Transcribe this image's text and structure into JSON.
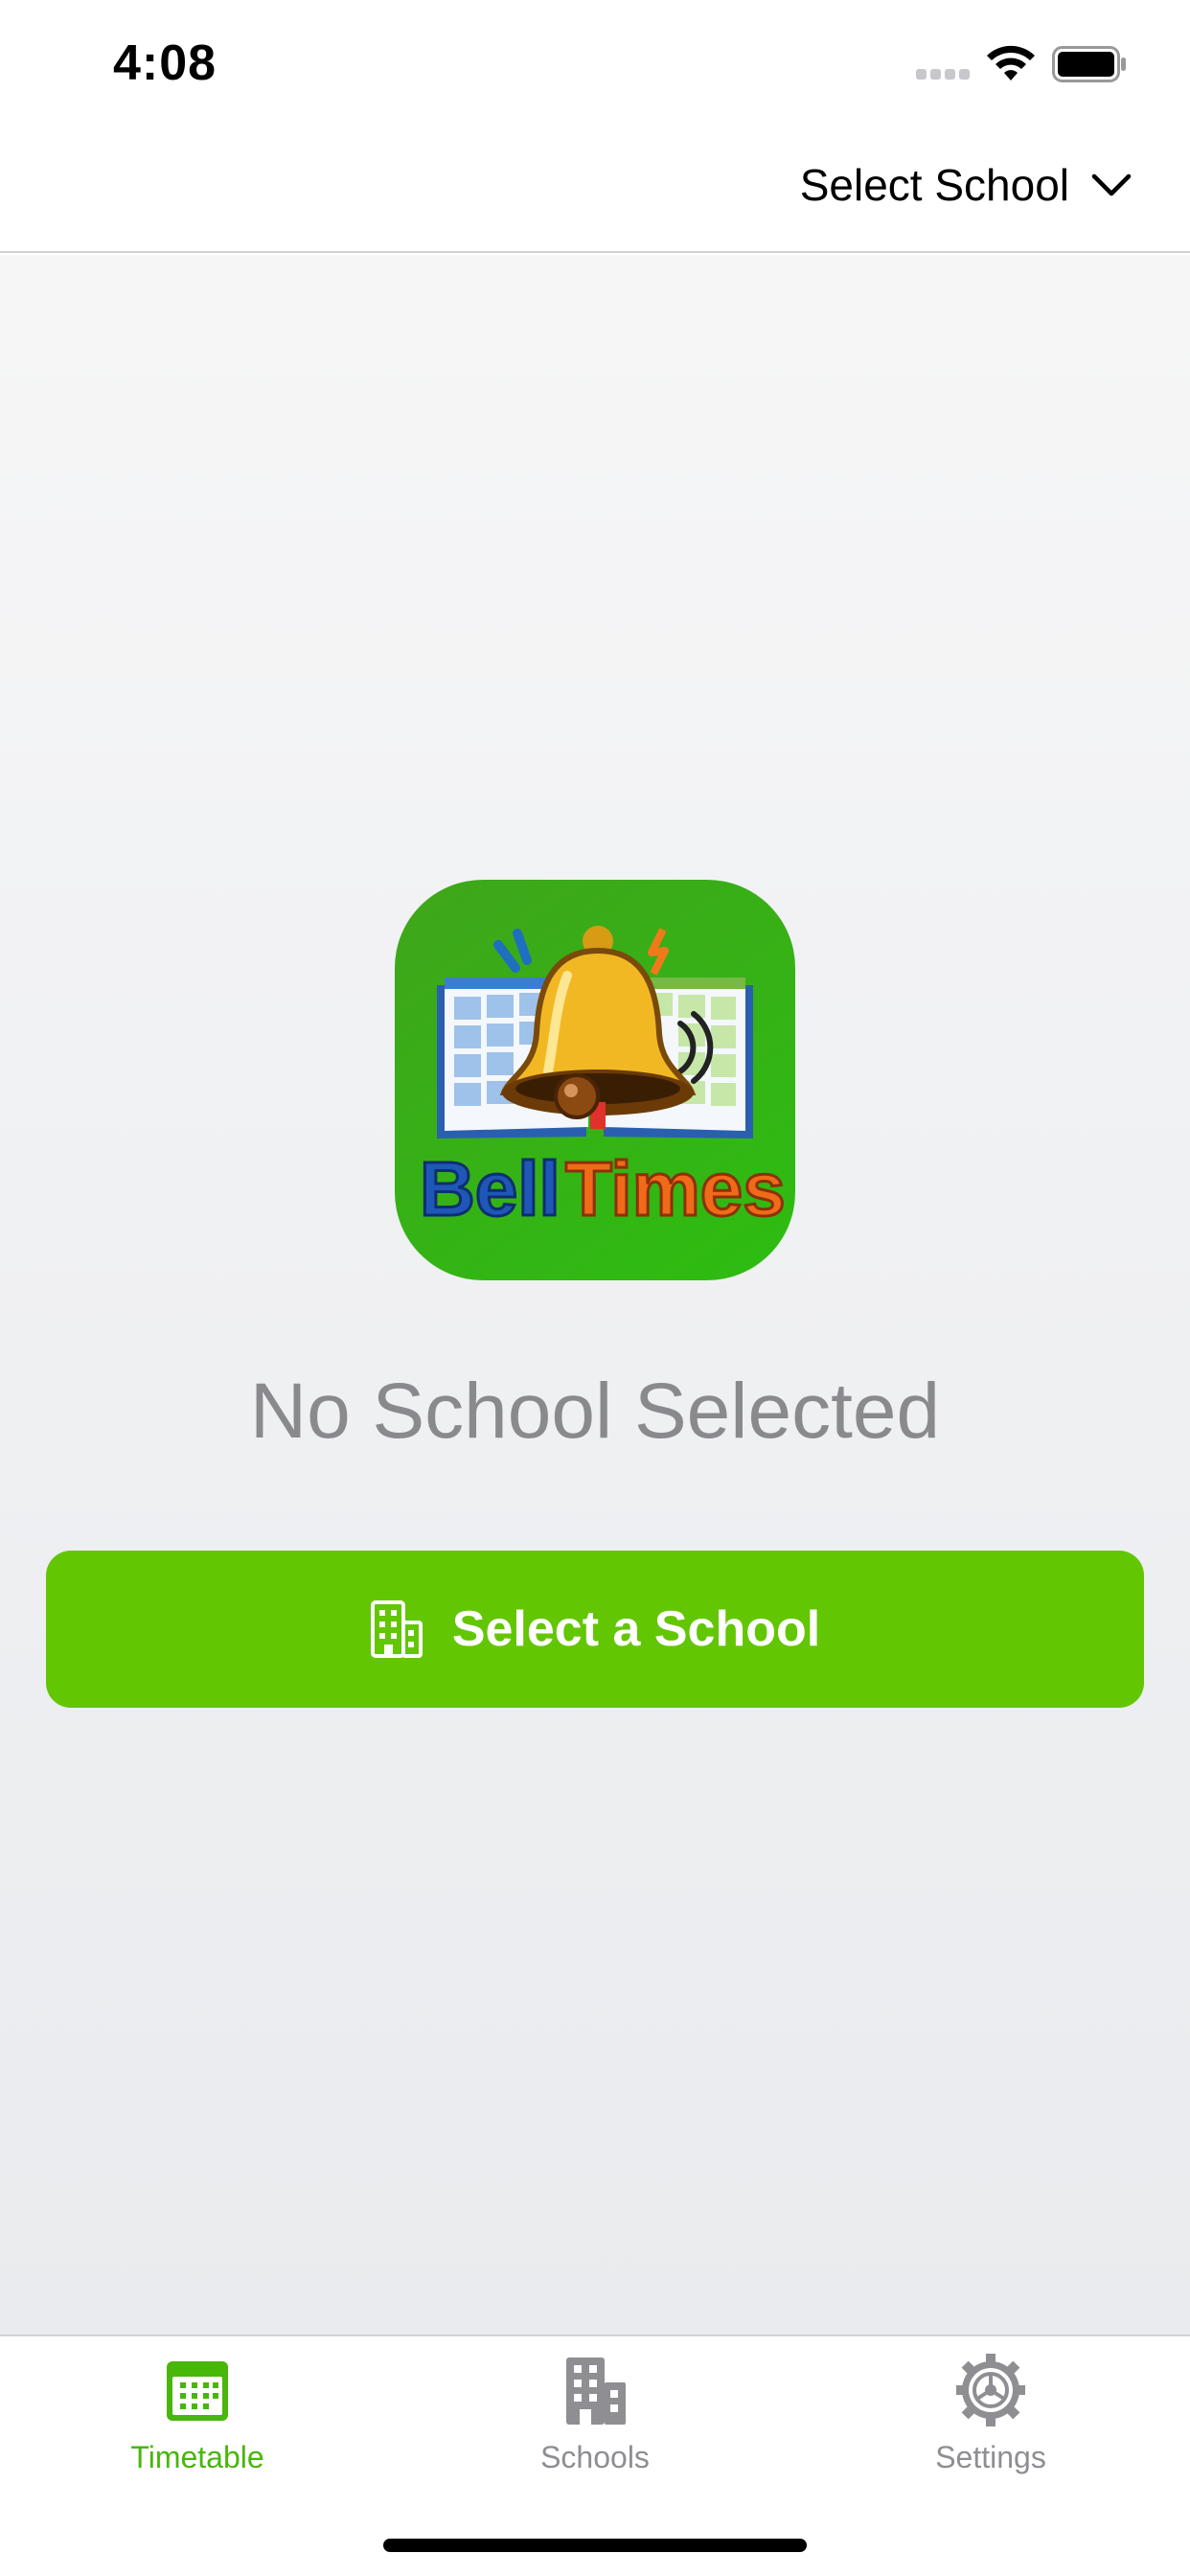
{
  "status_bar": {
    "time": "4:08",
    "signal_icon": "signal-dots-icon",
    "wifi_icon": "wifi-icon",
    "battery_icon": "battery-icon"
  },
  "header": {
    "school_picker_label": "Select School",
    "picker_icon": "chevron-down-icon"
  },
  "logo": {
    "word_left": "Bell",
    "word_right": "Times",
    "icon": "bell-times-app-icon"
  },
  "empty_state": {
    "title": "No School Selected",
    "button_label": "Select a School",
    "button_icon": "building-icon"
  },
  "tab_bar": {
    "tabs": [
      {
        "label": "Timetable",
        "icon": "calendar-icon",
        "active": true
      },
      {
        "label": "Schools",
        "icon": "building-icon",
        "active": false
      },
      {
        "label": "Settings",
        "icon": "gear-icon",
        "active": false
      }
    ]
  },
  "colors": {
    "accent": "#63c603",
    "tab_active": "#49b60a",
    "tab_inactive": "#8e8e93",
    "empty_text": "#8a8a8e"
  }
}
